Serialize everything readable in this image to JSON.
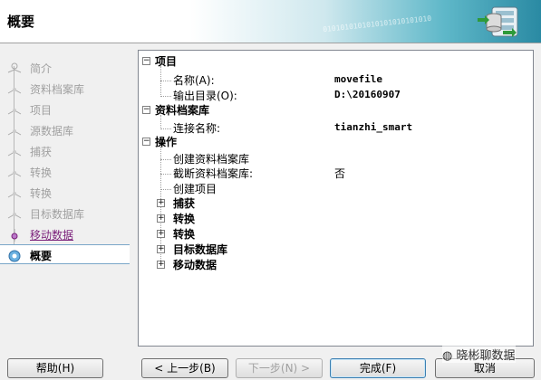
{
  "header": {
    "title": "概要",
    "binary_text": "0101010101010101010101010"
  },
  "steps": [
    {
      "label": "简介",
      "state": "pending"
    },
    {
      "label": "资料档案库",
      "state": "pending"
    },
    {
      "label": "项目",
      "state": "pending"
    },
    {
      "label": "源数据库",
      "state": "pending"
    },
    {
      "label": "捕获",
      "state": "pending"
    },
    {
      "label": "转换",
      "state": "pending"
    },
    {
      "label": "转换",
      "state": "pending"
    },
    {
      "label": "目标数据库",
      "state": "pending"
    },
    {
      "label": "移动数据",
      "state": "done"
    },
    {
      "label": "概要",
      "state": "active"
    }
  ],
  "tree": {
    "project": {
      "label": "项目",
      "name_label": "名称(A):",
      "name_value": "movefile",
      "output_label": "输出目录(O):",
      "output_value": "D:\\20160907"
    },
    "repository": {
      "label": "资料档案库",
      "conn_label": "连接名称:",
      "conn_value": "tianzhi_smart"
    },
    "operations": {
      "label": "操作",
      "create_repo": "创建资料档案库",
      "truncate_repo": "截断资料档案库:",
      "truncate_value": "否",
      "create_project": "创建项目",
      "capture": "捕获",
      "convert1": "转换",
      "convert2": "转换",
      "target_db": "目标数据库",
      "move_data": "移动数据"
    }
  },
  "buttons": {
    "help": "帮助(H)",
    "back": "< 上一步(B)",
    "next": "下一步(N) >",
    "finish": "完成(F)",
    "cancel": "取消"
  },
  "watermark": "晓彬聊数据"
}
